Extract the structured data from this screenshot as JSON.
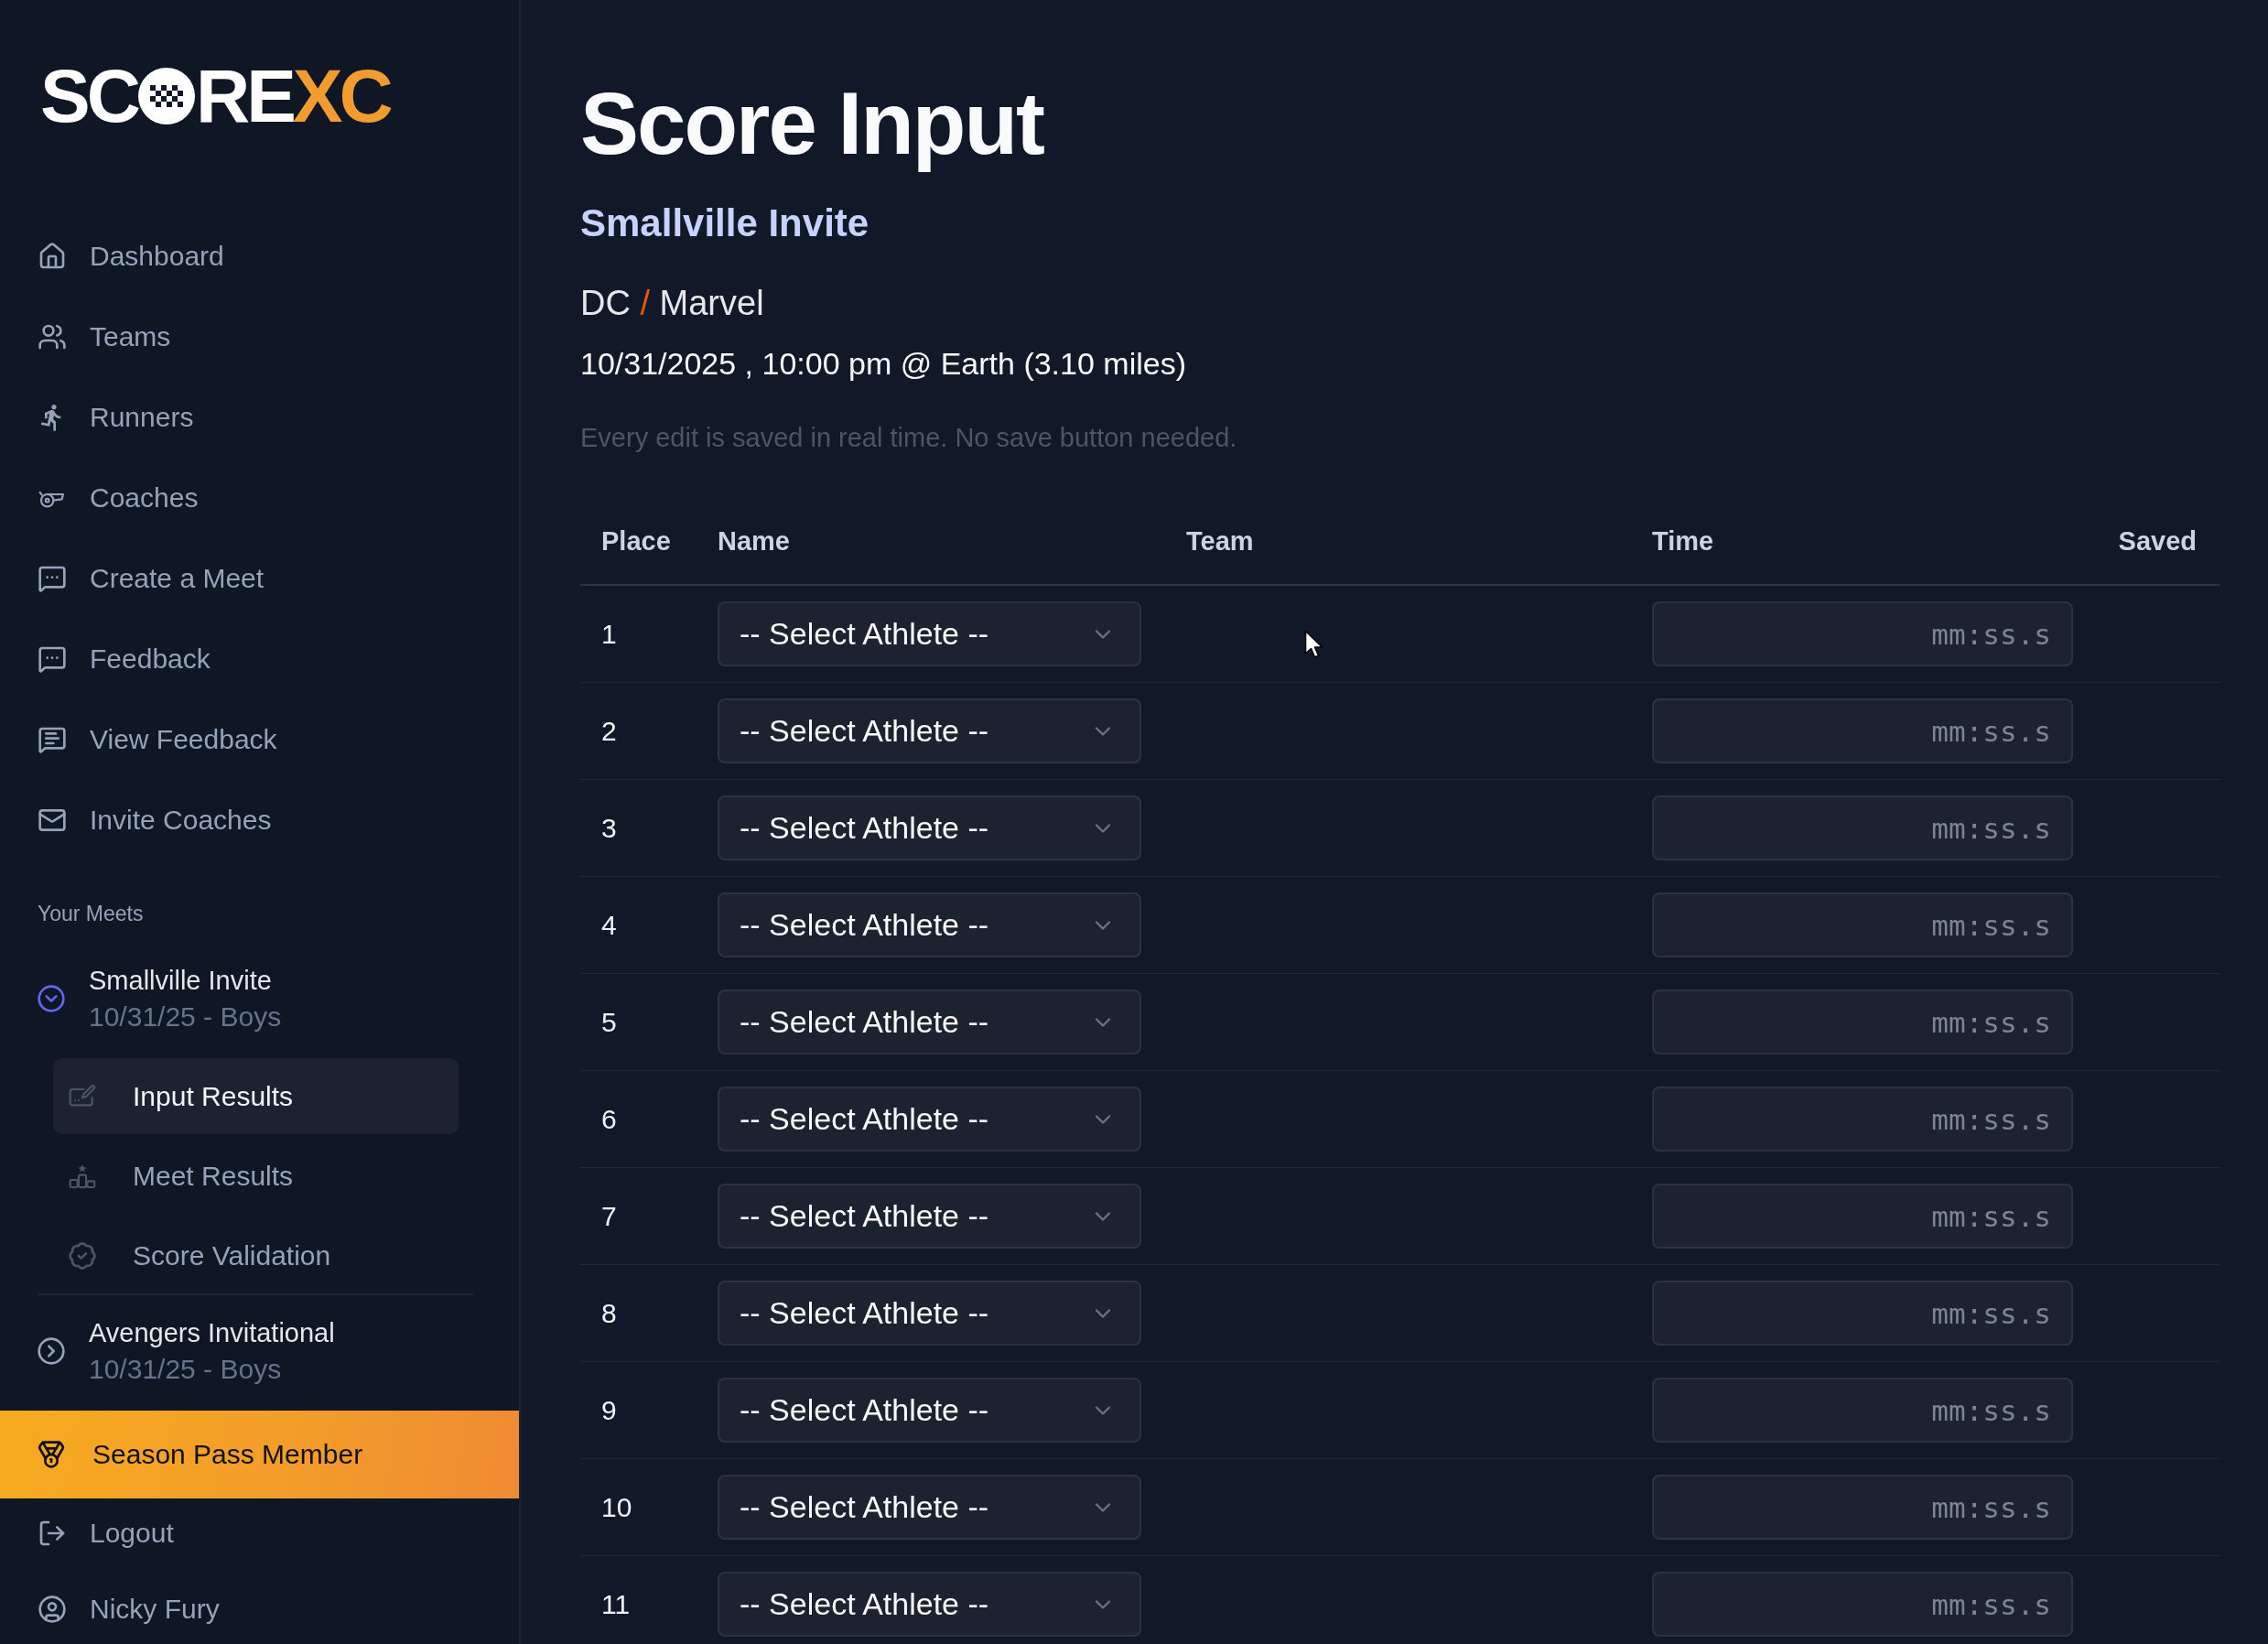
{
  "logo": {
    "start": "SC",
    "middle": "RE",
    "accent": "XC"
  },
  "sidebar": {
    "nav": [
      {
        "label": "Dashboard"
      },
      {
        "label": "Teams"
      },
      {
        "label": "Runners"
      },
      {
        "label": "Coaches"
      },
      {
        "label": "Create a Meet"
      },
      {
        "label": "Feedback"
      },
      {
        "label": "View Feedback"
      },
      {
        "label": "Invite Coaches"
      }
    ],
    "meets_heading": "Your Meets",
    "meets": [
      {
        "title": "Smallville Invite",
        "subtitle": "10/31/25 - Boys",
        "expanded": true,
        "children": [
          {
            "label": "Input Results",
            "selected": true
          },
          {
            "label": "Meet Results",
            "selected": false
          },
          {
            "label": "Score Validation",
            "selected": false
          }
        ]
      },
      {
        "title": "Avengers Invitational",
        "subtitle": "10/31/25 - Boys",
        "expanded": false
      }
    ],
    "promo": {
      "label": "Season Pass Member"
    },
    "footer": [
      {
        "label": "Logout"
      },
      {
        "label": "Nicky Fury"
      }
    ]
  },
  "page": {
    "title": "Score Input",
    "meet": "Smallville Invite",
    "teams": [
      "DC",
      "Marvel"
    ],
    "separator": "/",
    "details": "10/31/2025 , 10:00 pm @ Earth (3.10 miles)",
    "note": "Every edit is saved in real time. No save button needed."
  },
  "table": {
    "columns": [
      "Place",
      "Name",
      "Team",
      "Time",
      "Saved"
    ],
    "rows": [
      {
        "place": "1",
        "name": "-- Select Athlete --",
        "time_placeholder": "mm:ss.s"
      },
      {
        "place": "2",
        "name": "-- Select Athlete --",
        "time_placeholder": "mm:ss.s"
      },
      {
        "place": "3",
        "name": "-- Select Athlete --",
        "time_placeholder": "mm:ss.s"
      },
      {
        "place": "4",
        "name": "-- Select Athlete --",
        "time_placeholder": "mm:ss.s"
      },
      {
        "place": "5",
        "name": "-- Select Athlete --",
        "time_placeholder": "mm:ss.s"
      },
      {
        "place": "6",
        "name": "-- Select Athlete --",
        "time_placeholder": "mm:ss.s"
      },
      {
        "place": "7",
        "name": "-- Select Athlete --",
        "time_placeholder": "mm:ss.s"
      },
      {
        "place": "8",
        "name": "-- Select Athlete --",
        "time_placeholder": "mm:ss.s"
      },
      {
        "place": "9",
        "name": "-- Select Athlete --",
        "time_placeholder": "mm:ss.s"
      },
      {
        "place": "10",
        "name": "-- Select Athlete --",
        "time_placeholder": "mm:ss.s"
      },
      {
        "place": "11",
        "name": "-- Select Athlete --",
        "time_placeholder": "mm:ss.s"
      }
    ]
  }
}
